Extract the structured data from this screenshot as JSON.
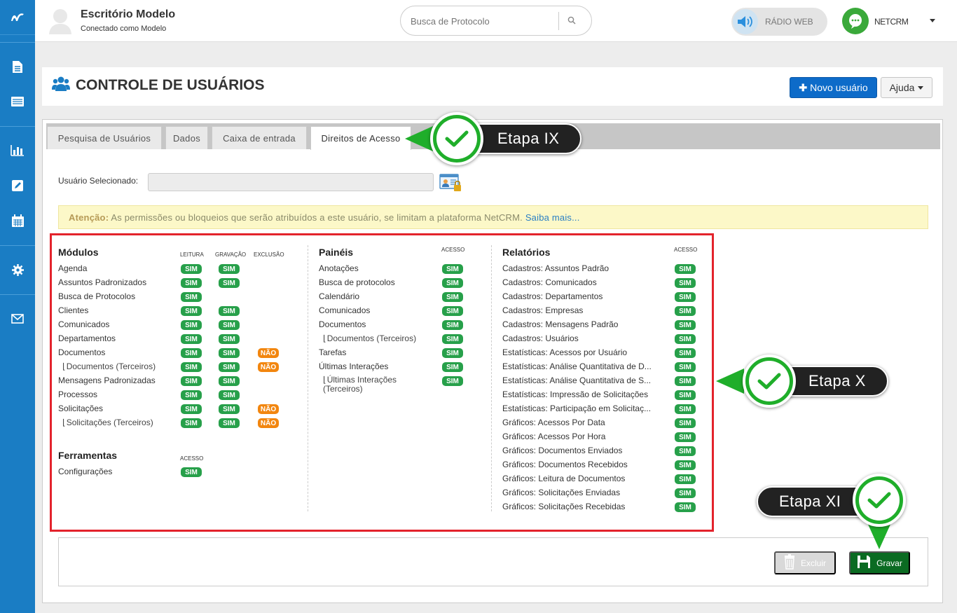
{
  "topbar": {
    "office_name": "Escritório Modelo",
    "connected_as": "Conectado como Modelo",
    "search_placeholder": "Busca de Protocolo",
    "radio_label": "RÁDIO WEB",
    "brand": "NETCRM"
  },
  "page": {
    "title": "CONTROLE DE USUÁRIOS",
    "new_user_label": "Novo usuário",
    "help_label": "Ajuda"
  },
  "tabs": [
    {
      "label": "Pesquisa de Usuários"
    },
    {
      "label": "Dados"
    },
    {
      "label": "Caixa de entrada"
    },
    {
      "label": "Direitos de Acesso",
      "active": true
    }
  ],
  "selected_user": {
    "label": "Usuário Selecionado:",
    "value": ""
  },
  "alert": {
    "bold": "Atenção:",
    "text": "As permissões ou bloqueios que serão atribuídos a este usuário, se limitam a plataforma NetCRM.",
    "link": "Saiba mais..."
  },
  "modulos": {
    "title": "Módulos",
    "headers": [
      "LEITURA",
      "GRAVAÇÃO",
      "EXCLUSÃO"
    ],
    "rows": [
      {
        "label": "Agenda",
        "leitura": "SIM",
        "gravacao": "SIM",
        "exclusao": ""
      },
      {
        "label": "Assuntos Padronizados",
        "leitura": "SIM",
        "gravacao": "SIM",
        "exclusao": ""
      },
      {
        "label": "Busca de Protocolos",
        "leitura": "SIM",
        "gravacao": "",
        "exclusao": ""
      },
      {
        "label": "Clientes",
        "leitura": "SIM",
        "gravacao": "SIM",
        "exclusao": ""
      },
      {
        "label": "Comunicados",
        "leitura": "SIM",
        "gravacao": "SIM",
        "exclusao": ""
      },
      {
        "label": "Departamentos",
        "leitura": "SIM",
        "gravacao": "SIM",
        "exclusao": ""
      },
      {
        "label": "Documentos",
        "leitura": "SIM",
        "gravacao": "SIM",
        "exclusao": "NÃO"
      },
      {
        "label": "Documentos (Terceiros)",
        "sub": true,
        "leitura": "SIM",
        "gravacao": "SIM",
        "exclusao": "NÃO"
      },
      {
        "label": "Mensagens Padronizadas",
        "leitura": "SIM",
        "gravacao": "SIM",
        "exclusao": ""
      },
      {
        "label": "Processos",
        "leitura": "SIM",
        "gravacao": "SIM",
        "exclusao": ""
      },
      {
        "label": "Solicitações",
        "leitura": "SIM",
        "gravacao": "SIM",
        "exclusao": "NÃO"
      },
      {
        "label": "Solicitações (Terceiros)",
        "sub": true,
        "leitura": "SIM",
        "gravacao": "SIM",
        "exclusao": "NÃO"
      }
    ]
  },
  "ferramentas": {
    "title": "Ferramentas",
    "header": "ACESSO",
    "rows": [
      {
        "label": "Configurações",
        "acesso": "SIM"
      }
    ]
  },
  "paineis": {
    "title": "Painéis",
    "header": "ACESSO",
    "rows": [
      {
        "label": "Anotações",
        "acesso": "SIM"
      },
      {
        "label": "Busca de protocolos",
        "acesso": "SIM"
      },
      {
        "label": "Calendário",
        "acesso": "SIM"
      },
      {
        "label": "Comunicados",
        "acesso": "SIM"
      },
      {
        "label": "Documentos",
        "acesso": "SIM"
      },
      {
        "label": "Documentos (Terceiros)",
        "sub": true,
        "acesso": "SIM"
      },
      {
        "label": "Tarefas",
        "acesso": "SIM"
      },
      {
        "label": "Últimas Interações",
        "acesso": "SIM"
      },
      {
        "label": "Últimas Interações (Terceiros)",
        "sub": true,
        "acesso": "SIM"
      }
    ]
  },
  "relatorios": {
    "title": "Relatórios",
    "header": "ACESSO",
    "rows": [
      {
        "label": "Cadastros: Assuntos Padrão",
        "acesso": "SIM"
      },
      {
        "label": "Cadastros: Comunicados",
        "acesso": "SIM"
      },
      {
        "label": "Cadastros: Departamentos",
        "acesso": "SIM"
      },
      {
        "label": "Cadastros: Empresas",
        "acesso": "SIM"
      },
      {
        "label": "Cadastros: Mensagens Padrão",
        "acesso": "SIM"
      },
      {
        "label": "Cadastros: Usuários",
        "acesso": "SIM"
      },
      {
        "label": "Estatísticas: Acessos por Usuário",
        "acesso": "SIM"
      },
      {
        "label": "Estatísticas: Análise Quantitativa de D...",
        "acesso": "SIM"
      },
      {
        "label": "Estatísticas: Análise Quantitativa de S...",
        "acesso": "SIM"
      },
      {
        "label": "Estatísticas: Impressão de Solicitações",
        "acesso": "SIM"
      },
      {
        "label": "Estatísticas: Participação em Solicitaç...",
        "acesso": "SIM"
      },
      {
        "label": "Gráficos: Acessos Por Data",
        "acesso": "SIM"
      },
      {
        "label": "Gráficos: Acessos Por Hora",
        "acesso": "SIM"
      },
      {
        "label": "Gráficos: Documentos Enviados",
        "acesso": "SIM"
      },
      {
        "label": "Gráficos: Documentos Recebidos",
        "acesso": "SIM"
      },
      {
        "label": "Gráficos: Leitura de Documentos",
        "acesso": "SIM"
      },
      {
        "label": "Gráficos: Solicitações Enviadas",
        "acesso": "SIM"
      },
      {
        "label": "Gráficos: Solicitações Recebidas",
        "acesso": "SIM"
      }
    ]
  },
  "footer": {
    "delete_label": "Excluir",
    "save_label": "Gravar"
  },
  "callouts": {
    "step9": "Etapa IX",
    "step10": "Etapa X",
    "step11": "Etapa XI"
  },
  "colors": {
    "sim": "#27a04a",
    "nao": "#f2860f",
    "rail": "#1a7dc4",
    "primary": "#0d6bc9",
    "save": "#0b6b22",
    "highlight": "#e3232c",
    "check": "#1fae2a"
  }
}
